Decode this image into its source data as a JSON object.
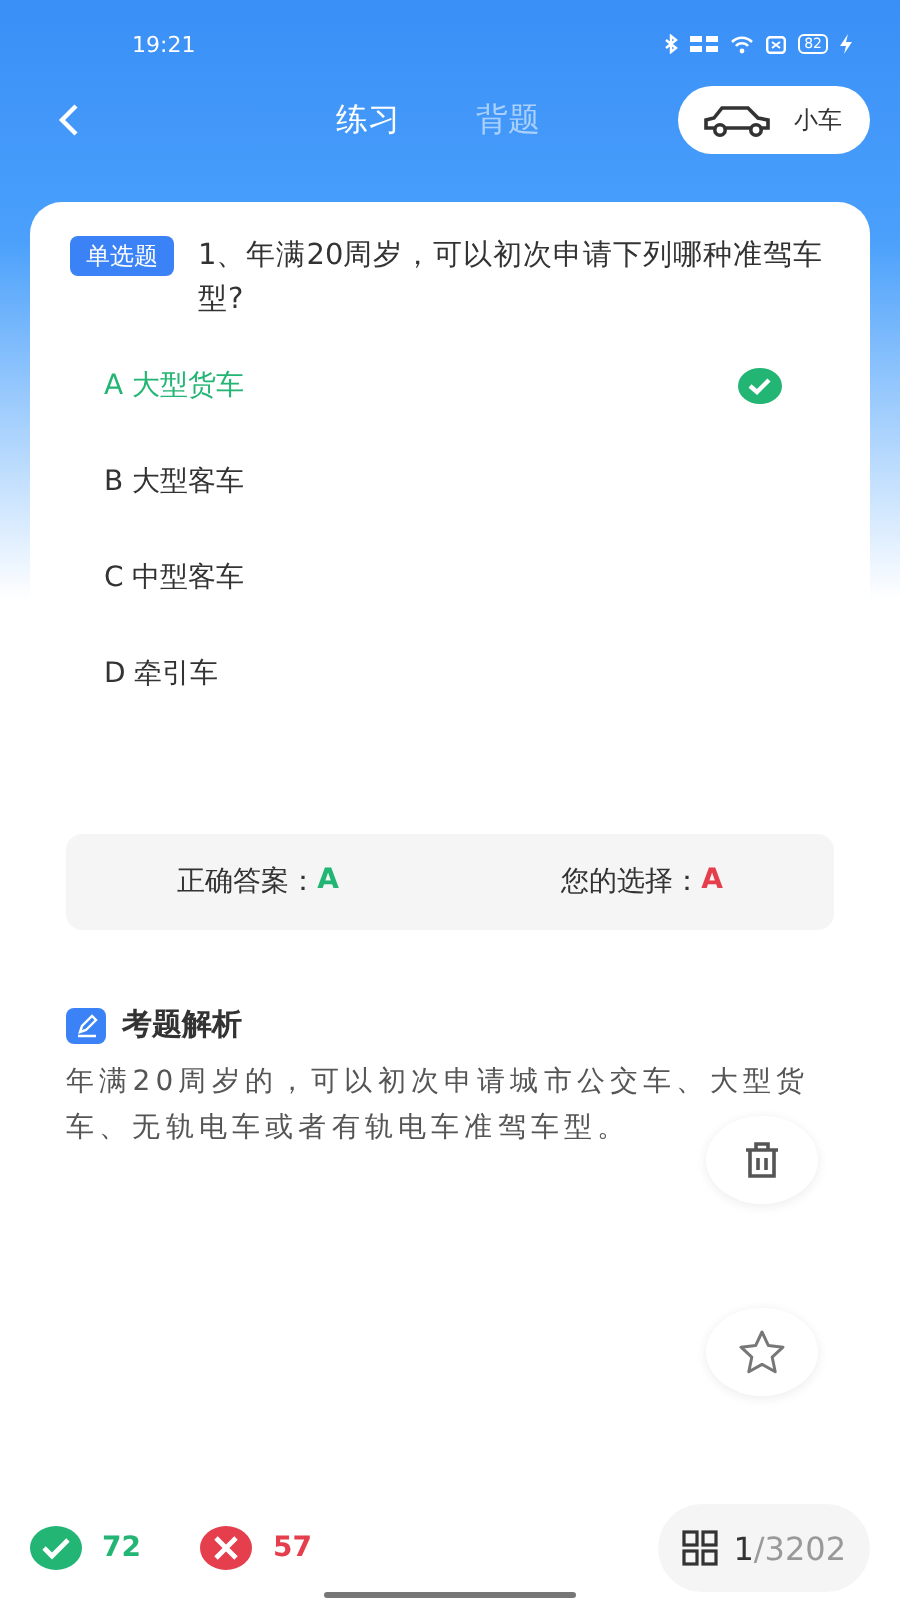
{
  "status_bar": {
    "time": "19:21",
    "battery": "82"
  },
  "header": {
    "tabs": [
      {
        "label": "练习",
        "selected": true
      },
      {
        "label": "背题",
        "selected": false
      }
    ],
    "vehicle": "小车"
  },
  "question": {
    "tag": "单选题",
    "text": "1、年满20周岁，可以初次申请下列哪种准驾车型?",
    "options": [
      {
        "label": "A 大型货车",
        "selected": true
      },
      {
        "label": "B 大型客车",
        "selected": false
      },
      {
        "label": "C 中型客车",
        "selected": false
      },
      {
        "label": "D 牵引车",
        "selected": false
      }
    ]
  },
  "answer": {
    "correct_label": "正确答案：",
    "correct": "A",
    "chosen_label": "您的选择：",
    "chosen": "A"
  },
  "analysis": {
    "title": "考题解析",
    "text": "年满20周岁的，可以初次申请城市公交车、大型货车、无轨电车或者有轨电车准驾车型。"
  },
  "footer": {
    "right_count": "72",
    "wrong_count": "57",
    "current": "1",
    "total": "/3202"
  }
}
